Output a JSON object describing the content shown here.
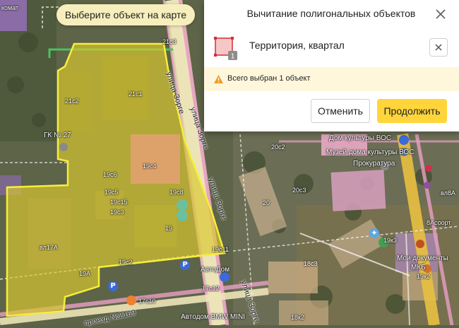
{
  "hint": {
    "text": "Выберите объект на карте"
  },
  "panel": {
    "title": "Вычитание полигональных объектов",
    "object": {
      "name": "Территория, квартал",
      "count_badge": "1"
    },
    "warning": "Всего выбран 1 объект",
    "cancel_label": "Отменить",
    "continue_label": "Продолжить"
  },
  "colors": {
    "accent_button": "#ffd53b",
    "selection_fill": "#d8c92f",
    "selection_stroke": "#f6ee3a",
    "highlight_fill": "#f0a080",
    "warning_bg": "#fff7dc"
  },
  "map": {
    "labels": {
      "komat": "комат",
      "c21c3": "21с3",
      "c21c1": "21с1",
      "c21c2": "21с2",
      "gk27": "ГК № 27",
      "c19c4": "19с4",
      "c19c6": "19с6",
      "c19c5": "19с5",
      "c19c8": "19с8",
      "c19c15": "19с15",
      "c19c3": "19с3",
      "c19": "19",
      "c19c11": "19с11",
      "c17a": "вл17А",
      "c19c2": "19с2",
      "c19a": "19А",
      "avtodom": "АвтоДом",
      "c17c12": "17с12",
      "c17c10": "17с10",
      "avtodom_bmw": "Автодом BMW MINI",
      "street1": "улица Зорге",
      "street2": "улица Зорге",
      "street3": "улица Зорге",
      "street4": "улица Зорге",
      "street_bottom": "проезд №2169",
      "dk_vos": "Дом культуры ВОС",
      "c20c2": "20с2",
      "museum_vos": "Музей дома культуры ВОС",
      "prokuratura": "Прокуратура",
      "c20c3": "20с3",
      "c20": "20",
      "c19k3": "19к3",
      "c18c3": "18с3",
      "moi_docs": "Мои документы",
      "mkb": "МКБ",
      "c19k2": "19к2",
      "c18k2": "18к2",
      "vl8a": "вл8А",
      "c8acoopt": "8Асоорт"
    }
  }
}
